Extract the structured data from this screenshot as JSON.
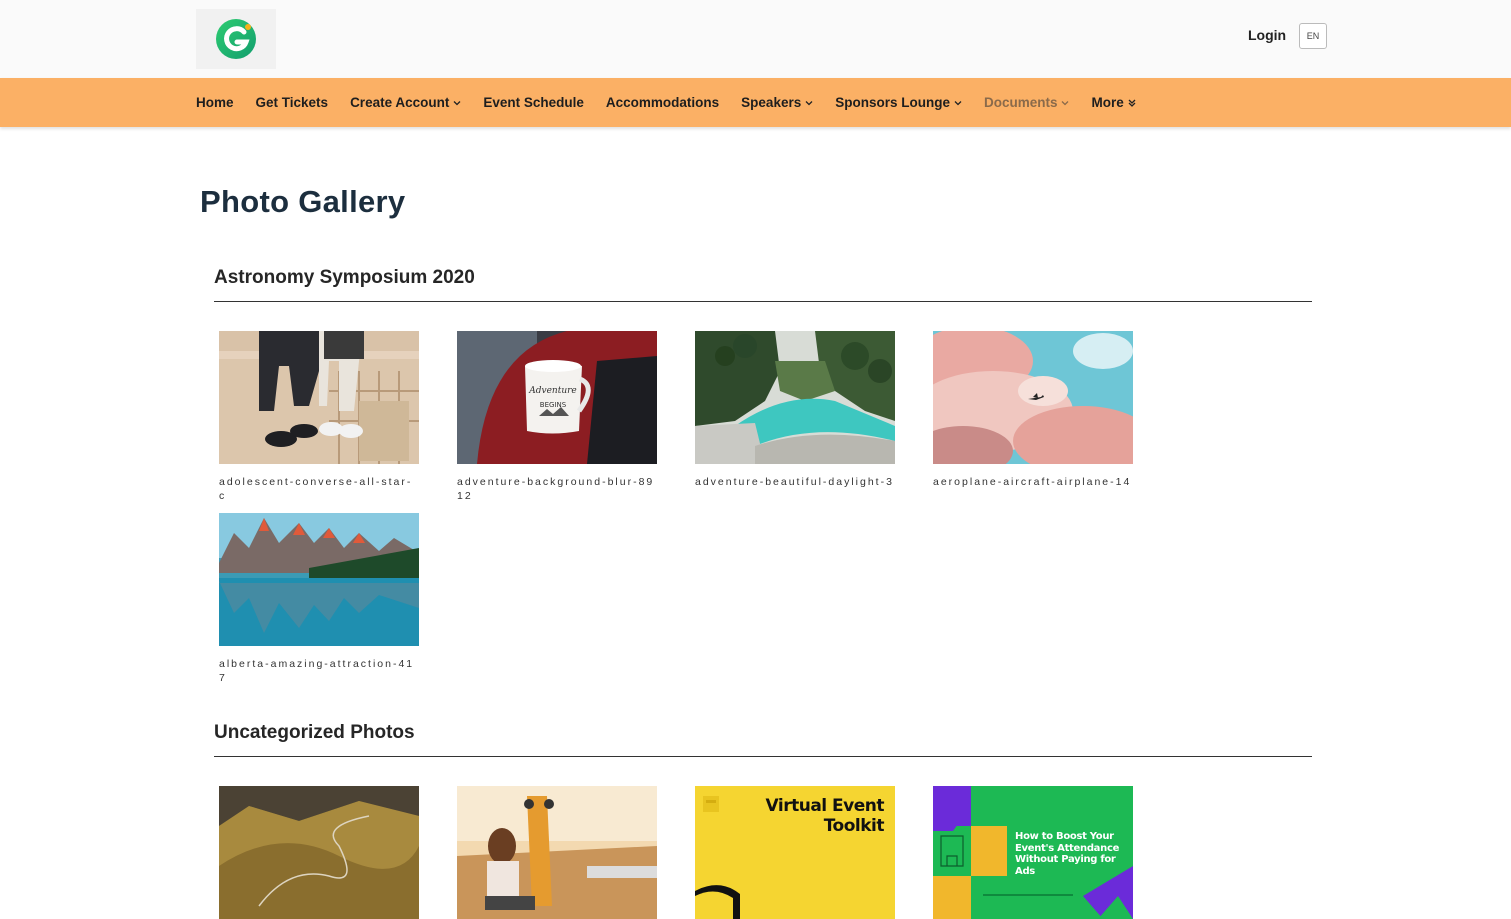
{
  "header": {
    "login_label": "Login",
    "language": "EN"
  },
  "nav": {
    "items": [
      {
        "label": "Home",
        "dropdown": false
      },
      {
        "label": "Get Tickets",
        "dropdown": false
      },
      {
        "label": "Create Account",
        "dropdown": true
      },
      {
        "label": "Event Schedule",
        "dropdown": false
      },
      {
        "label": "Accommodations",
        "dropdown": false
      },
      {
        "label": "Speakers",
        "dropdown": true
      },
      {
        "label": "Sponsors Lounge",
        "dropdown": true
      },
      {
        "label": "Documents",
        "dropdown": true
      },
      {
        "label": "More",
        "dropdown": true
      }
    ],
    "bar_color": "#fbb065"
  },
  "page": {
    "title": "Photo Gallery"
  },
  "sections": [
    {
      "title": "Astronomy Symposium 2020",
      "photos": [
        {
          "caption": "adolescent-converse-all-star-c"
        },
        {
          "caption": "adventure-background-blur-8912"
        },
        {
          "caption": "adventure-beautiful-daylight-3"
        },
        {
          "caption": "aeroplane-aircraft-airplane-14"
        },
        {
          "caption": "alberta-amazing-attraction-417"
        }
      ]
    },
    {
      "title": "Uncategorized Photos",
      "photos": [
        {
          "caption": ""
        },
        {
          "caption": ""
        },
        {
          "caption": "",
          "card_text": [
            "Virtual Event",
            "Toolkit"
          ]
        },
        {
          "caption": "",
          "card_text": [
            "How to Boost Your",
            "Event's Attendance",
            "Without Paying for Ads"
          ]
        }
      ]
    }
  ]
}
